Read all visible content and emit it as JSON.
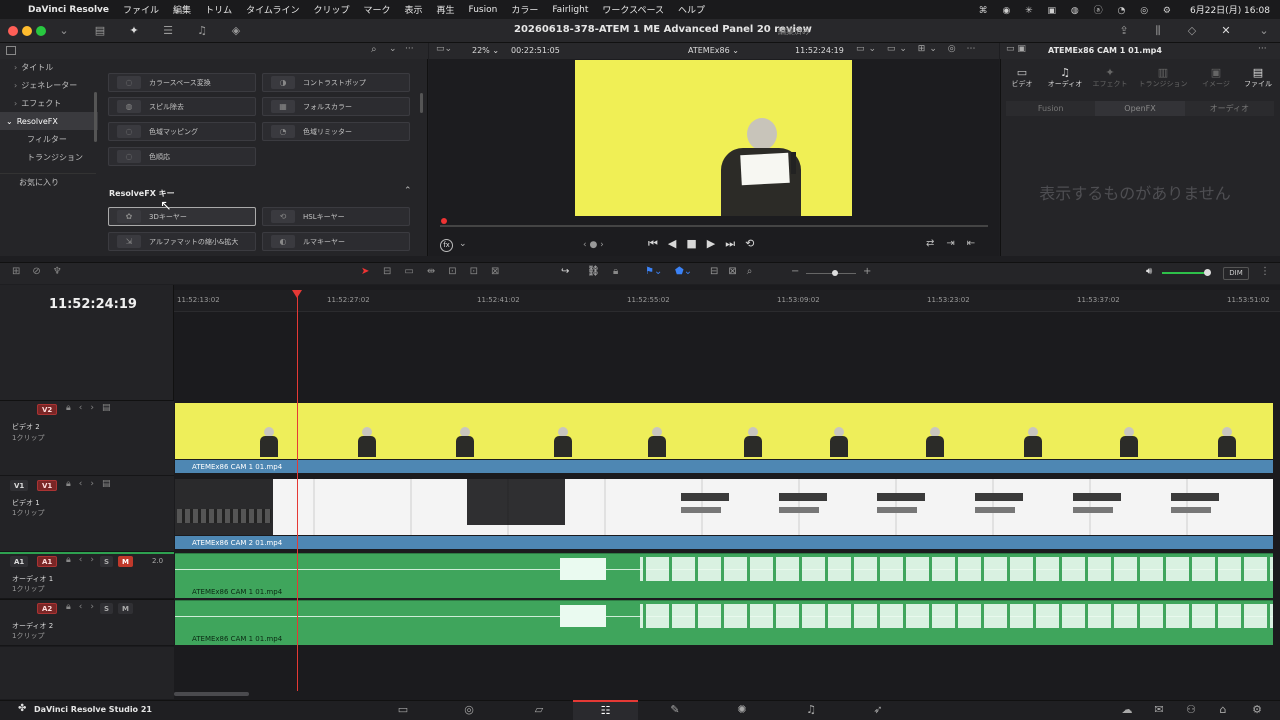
{
  "menubar": {
    "app": "DaVinci Resolve",
    "items": [
      "ファイル",
      "編集",
      "トリム",
      "タイムライン",
      "クリップ",
      "マーク",
      "表示",
      "再生",
      "Fusion",
      "カラー",
      "Fairlight",
      "ワークスペース",
      "ヘルプ"
    ],
    "clock": "6月22日(月)  16:08"
  },
  "title": {
    "project": "20260618-378-ATEM 1 ME Advanced Panel 20 review",
    "status": "編集済み"
  },
  "sidebar": {
    "items": [
      "タイトル",
      "ジェネレーター",
      "エフェクト",
      "ResolveFX",
      "フィルター",
      "トランジション",
      "お気に入り"
    ]
  },
  "effects": {
    "top_row": [
      "カラースペース変換",
      "コントラストポップ",
      "スピル除去",
      "フォルスカラー",
      "色域マッピング",
      "色域リミッター",
      "色順応"
    ],
    "section_title": "ResolveFX キー",
    "key_items": [
      "3Dキーヤー",
      "HSLキーヤー",
      "アルファマットの縮小&拡大",
      "ルマキーヤー"
    ]
  },
  "viewer": {
    "zoom": "22%",
    "duration": "00:22:51:05",
    "clip_name": "ATEMEx86",
    "timecode": "11:52:24:19"
  },
  "inspector": {
    "clip": "ATEMEx86 CAM 1 01.mp4",
    "tabs": [
      "ビデオ",
      "オーディオ",
      "エフェクト",
      "トランジション",
      "イメージ",
      "ファイル"
    ],
    "subtabs": [
      "Fusion",
      "OpenFX",
      "オーディオ"
    ],
    "empty": "表示するものがありません"
  },
  "toolbar": {
    "dim": "DIM"
  },
  "timeline": {
    "timecode": "11:52:24:19",
    "ticks": [
      "11:52:13:02",
      "11:52:27:02",
      "11:52:41:02",
      "11:52:55:02",
      "11:53:09:02",
      "11:53:23:02",
      "11:53:37:02",
      "11:53:51:02"
    ],
    "tracks": [
      {
        "id": "V2",
        "name": "ビデオ 2",
        "count": "1クリップ",
        "clip": "ATEMEx86 CAM 1 01.mp4"
      },
      {
        "id": "V1",
        "name": "ビデオ 1",
        "count": "1クリップ",
        "clip": "ATEMEx86 CAM 2 01.mp4"
      },
      {
        "id": "A1",
        "name": "オーディオ 1",
        "count": "1クリップ",
        "clip": "ATEMEx86 CAM 1 01.mp4",
        "level": "2.0"
      },
      {
        "id": "A2",
        "name": "オーディオ 2",
        "count": "1クリップ",
        "clip": "ATEMEx86 CAM 1 01.mp4"
      }
    ],
    "solo": "S",
    "mute": "M"
  },
  "footer": {
    "app": "DaVinci Resolve Studio 21"
  }
}
